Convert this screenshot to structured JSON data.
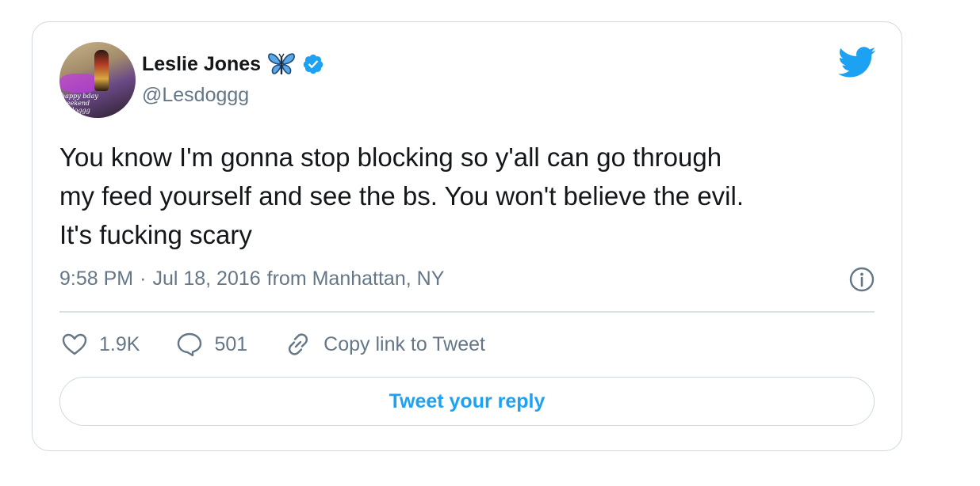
{
  "tweet": {
    "author": {
      "display_name": "Leslie Jones",
      "handle": "@Lesdoggg",
      "verified": true,
      "avatar_caption": "happy bday\nweekend\nlesdoggg"
    },
    "text": "You know I'm gonna stop blocking so y'all can go through\nmy feed yourself and see the bs. You won't believe the evil.\nIt's fucking scary",
    "time": "9:58 PM",
    "separator": "·",
    "date": "Jul 18, 2016",
    "location": "from Manhattan, NY",
    "likes": "1.9K",
    "replies": "501",
    "copy_link_label": "Copy link to Tweet",
    "reply_prompt": "Tweet your reply"
  },
  "colors": {
    "brand_blue": "#1da1f2",
    "muted_text": "#657786",
    "border": "#cfd9de"
  },
  "icons": {
    "name_emoji": "butterfly-icon",
    "verified": "verified-badge-icon",
    "brand": "twitter-bird-icon",
    "info": "info-icon",
    "like": "heart-icon",
    "reply": "comment-icon",
    "copy_link": "link-icon"
  }
}
